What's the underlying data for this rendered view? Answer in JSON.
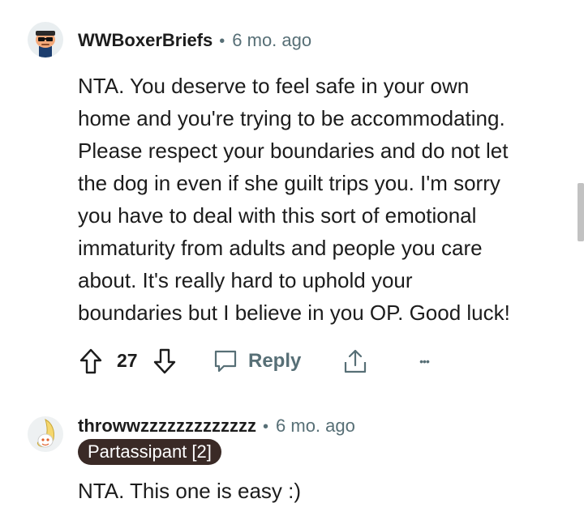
{
  "comments": [
    {
      "author": "WWBoxerBriefs",
      "time": "6 mo. ago",
      "separator": "•",
      "avatar_icon": "avatar-snoo-sunglasses-icon",
      "body_lines": [
        "NTA. You deserve to feel safe in your own",
        "home and you're trying to be accommodating.",
        "Please respect your boundaries and do not let",
        "the dog in even if she guilt trips you. I'm sorry",
        "you have to deal with this sort of emotional",
        "immaturity from adults and people you care",
        "about. It's really hard to uphold your",
        "boundaries but I believe in you OP. Good luck!"
      ],
      "vote_count": "27",
      "reply_label": "Reply",
      "more_label": "•••"
    },
    {
      "author": "throwwzzzzzzzzzzzzz",
      "time": "6 mo. ago",
      "separator": "•",
      "avatar_icon": "avatar-snoo-banana-icon",
      "flair": "Partassipant [2]",
      "body_lines": [
        "NTA. This one is easy :)"
      ]
    }
  ],
  "colors": {
    "text": "#1c1c1c",
    "meta": "#576f76",
    "flair_bg": "#3a2a26",
    "flair_text": "#ffffff"
  }
}
